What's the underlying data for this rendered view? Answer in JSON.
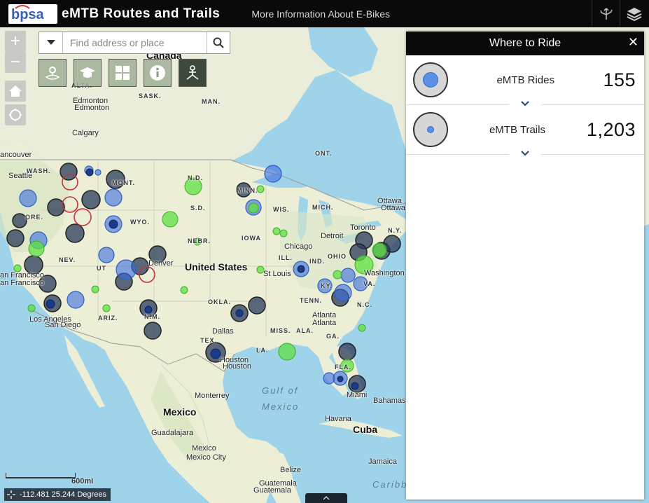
{
  "header": {
    "logo_text": "bpsa",
    "title": "eMTB Routes and Trails",
    "info_link": "More Information About E-Bikes"
  },
  "search": {
    "placeholder": "Find address or place"
  },
  "panel": {
    "title": "Where to Ride",
    "rows": [
      {
        "name": "eMTB Rides",
        "count": "155"
      },
      {
        "name": "eMTB Trails",
        "count": "1,203"
      }
    ]
  },
  "map": {
    "labels": {
      "canada": "Canada",
      "alta": "ALTA.",
      "sask": "SASK.",
      "man": "MAN.",
      "ont": "ONT.",
      "edmonton1": "Edmonton",
      "edmonton2": "Edmonton",
      "calgary": "Calgary",
      "vancouver": "ancouver",
      "seattle": "Seattle",
      "wash": "WASH.",
      "mont": "MONT.",
      "nd": "N.D.",
      "minn": "MINN.",
      "sd": "S.D.",
      "wis": "WIS.",
      "mich": "MICH.",
      "ore": "ORE.",
      "wyo": "WYO.",
      "nebr": "NEBR.",
      "iowa": "IOWA",
      "chicago": "Chicago",
      "detroit": "Detroit",
      "toronto": "Toronto",
      "ottawa1": "Ottawa",
      "ottawa2": "Ottawa",
      "ny": "N.Y.",
      "nev": "NEV.",
      "ut": "UT",
      "denver": "Denver",
      "us": "United States",
      "ill": "ILL.",
      "ind": "IND.",
      "ohio": "OHIO",
      "stlouis": "St Louis",
      "washington": "Washington",
      "sf1": "an Francisco",
      "sf2": "an Francisco",
      "ky": "KY.",
      "va": "VA.",
      "okla": "OKLA.",
      "tenn": "TENN.",
      "nc": "N.C.",
      "la1": "Los Angeles",
      "sandiego": "San Diego",
      "ariz": "ARIZ.",
      "nm": "N.M.",
      "atlanta1": "Atlanta",
      "atlanta2": "Atlanta",
      "dallas": "Dallas",
      "miss": "MISS.",
      "ala": "ALA.",
      "ga": "GA.",
      "tex": "TEX.",
      "la": "LA.",
      "houston1": "Houston",
      "houston2": "Houston",
      "fla": "FLA.",
      "gulf1": "Gulf of",
      "gulf2": "Mexico",
      "miami": "Miami",
      "bahamas": "Bahamas",
      "monterrey": "Monterrey",
      "mexico": "Mexico",
      "havana": "Havana",
      "cuba": "Cuba",
      "guadalajara": "Guadalajara",
      "mexicocity1": "Mexico",
      "mexicocity2": "Mexico City",
      "belize": "Belize",
      "jamaica": "Jamaica",
      "guatemala1": "Guatemala",
      "guatemala2": "Guatemala",
      "caribbean": "Caribb"
    },
    "scale_label": "600mi",
    "coordinates": "-112.481 25.244 Degrees"
  },
  "colors": {
    "header_bg": "#0a0a0a",
    "water": "#9fd3ea",
    "land": "#e9edd9",
    "ride_marker": "#5b8fe6",
    "trail_marker": "#7fe35a"
  }
}
